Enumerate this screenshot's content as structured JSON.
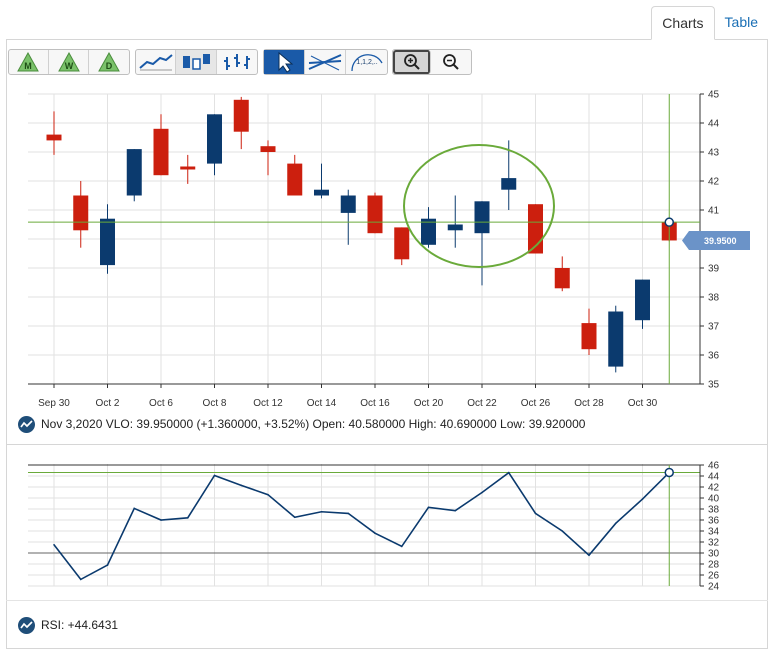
{
  "tabs": [
    {
      "label": "Charts",
      "active": true
    },
    {
      "label": "Table",
      "active": false
    }
  ],
  "toolbar": {
    "periods": [
      "M",
      "W",
      "D"
    ],
    "chart_types": [
      "line-chart-icon",
      "candlestick-icon",
      "ohlc-icon"
    ],
    "tools": [
      "cursor-icon",
      "trendline-icon",
      "fibonacci-icon"
    ],
    "fib_label": "1,1,2,..",
    "zoom": [
      "zoom-in-icon",
      "zoom-out-icon"
    ]
  },
  "colors": {
    "up": "#0b3a6e",
    "down": "#cc1f0e",
    "crosshair": "#6aaa3a",
    "circle": "#6aaa3a",
    "rsi_line": "#0b3a6e",
    "price_tag": "#6b93c8",
    "grid": "#e2e2e2"
  },
  "price_tag_label": "39.9500",
  "info_text": "Nov 3,2020 VLO: 39.950000 (+1.360000, +3.52%) Open: 40.580000 High: 40.690000 Low: 39.920000",
  "rsi_text": "RSI: +44.6431",
  "chart_data": [
    {
      "type": "candlestick",
      "x_labels": [
        "Sep 30",
        "Oct 2",
        "Oct 6",
        "Oct 8",
        "Oct 12",
        "Oct 14",
        "Oct 16",
        "Oct 20",
        "Oct 22",
        "Oct 26",
        "Oct 28",
        "Oct 30"
      ],
      "ylim": [
        35,
        45
      ],
      "y_ticks": [
        35,
        36,
        37,
        38,
        39,
        40,
        41,
        42,
        43,
        44,
        45
      ],
      "crosshair_price": 40.58,
      "candles": [
        {
          "o": 43.6,
          "h": 44.4,
          "l": 42.9,
          "c": 43.4
        },
        {
          "o": 41.5,
          "h": 42.0,
          "l": 39.7,
          "c": 40.3
        },
        {
          "o": 39.1,
          "h": 41.2,
          "l": 38.8,
          "c": 40.7
        },
        {
          "o": 41.5,
          "h": 43.1,
          "l": 41.3,
          "c": 43.1
        },
        {
          "o": 43.8,
          "h": 44.3,
          "l": 42.2,
          "c": 42.2
        },
        {
          "o": 42.5,
          "h": 42.9,
          "l": 41.9,
          "c": 42.4
        },
        {
          "o": 42.6,
          "h": 44.3,
          "l": 42.2,
          "c": 44.3
        },
        {
          "o": 44.8,
          "h": 44.9,
          "l": 43.1,
          "c": 43.7
        },
        {
          "o": 43.2,
          "h": 43.4,
          "l": 42.2,
          "c": 43.0
        },
        {
          "o": 42.6,
          "h": 42.9,
          "l": 41.5,
          "c": 41.5
        },
        {
          "o": 41.5,
          "h": 42.6,
          "l": 41.4,
          "c": 41.7
        },
        {
          "o": 40.9,
          "h": 41.7,
          "l": 39.8,
          "c": 41.5
        },
        {
          "o": 41.5,
          "h": 41.6,
          "l": 40.2,
          "c": 40.2
        },
        {
          "o": 40.4,
          "h": 40.4,
          "l": 39.1,
          "c": 39.3
        },
        {
          "o": 39.8,
          "h": 41.1,
          "l": 39.7,
          "c": 40.7
        },
        {
          "o": 40.3,
          "h": 41.5,
          "l": 39.7,
          "c": 40.5
        },
        {
          "o": 40.2,
          "h": 41.3,
          "l": 38.4,
          "c": 41.3
        },
        {
          "o": 41.7,
          "h": 43.4,
          "l": 41.0,
          "c": 42.1
        },
        {
          "o": 41.2,
          "h": 41.2,
          "l": 39.5,
          "c": 39.5
        },
        {
          "o": 39.0,
          "h": 39.4,
          "l": 38.2,
          "c": 38.3
        },
        {
          "o": 37.1,
          "h": 37.6,
          "l": 36.0,
          "c": 36.2
        },
        {
          "o": 35.6,
          "h": 37.7,
          "l": 35.4,
          "c": 37.5
        },
        {
          "o": 37.2,
          "h": 38.6,
          "l": 36.9,
          "c": 38.6
        },
        {
          "o": 40.58,
          "h": 40.69,
          "l": 39.92,
          "c": 39.95
        }
      ],
      "last_close": 39.95
    },
    {
      "type": "line",
      "name": "RSI",
      "ylim": [
        24,
        46
      ],
      "y_ticks": [
        24,
        26,
        28,
        30,
        32,
        34,
        36,
        38,
        40,
        42,
        44,
        46
      ],
      "ref_lines": [
        30,
        44.6431
      ],
      "values": [
        31.5,
        25.2,
        27.8,
        38.1,
        36.0,
        36.4,
        44.1,
        42.3,
        40.6,
        36.5,
        37.5,
        37.2,
        33.6,
        31.2,
        38.3,
        37.7,
        41.0,
        44.6,
        37.2,
        34.0,
        29.6,
        35.4,
        39.8,
        44.6431
      ],
      "last_value": 44.6431
    }
  ]
}
